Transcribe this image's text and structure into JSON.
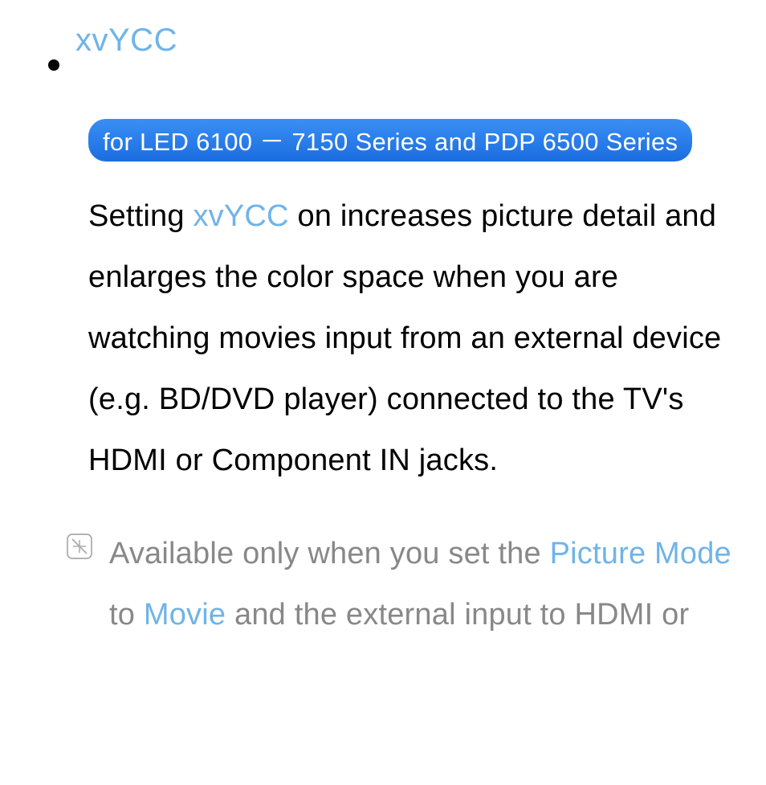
{
  "bullet": {
    "title": "xvYCC"
  },
  "badge": "for LED 6100 － 7150 Series and PDP 6500 Series",
  "body": {
    "pre": "Setting ",
    "hl": "xvYCC",
    "post": " on increases picture detail and enlarges the color space when you are watching movies input from an external device (e.g. BD/DVD player) connected to the TV's HDMI or Component IN jacks."
  },
  "note": {
    "p1": "Available only when you set the ",
    "hl1": "Picture Mode",
    "p2": " to ",
    "hl2": "Movie",
    "p3": " and the external input to HDMI or"
  }
}
